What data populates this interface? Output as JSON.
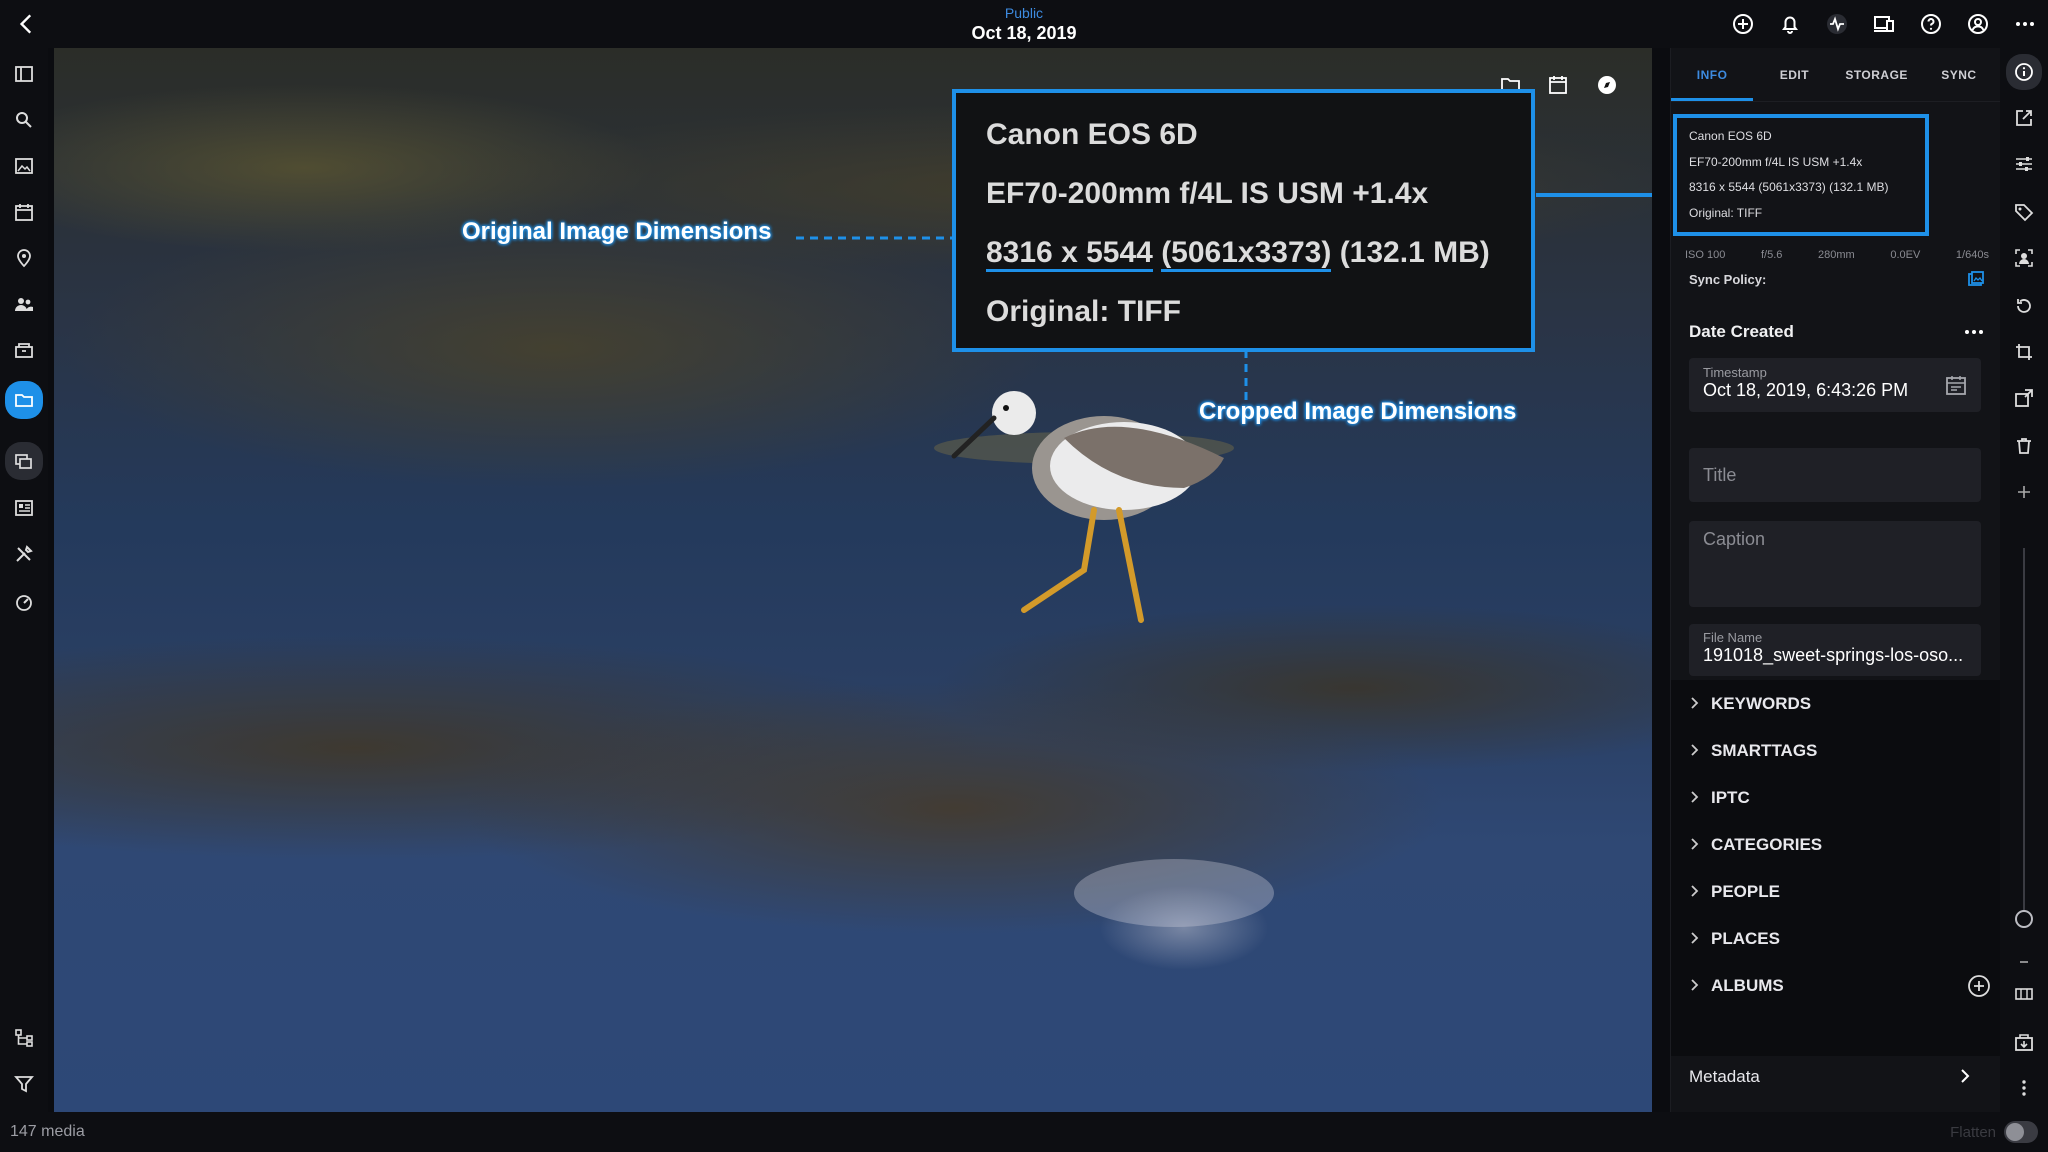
{
  "header": {
    "visibility": "Public",
    "date": "Oct 18, 2019",
    "icons": [
      "add-circle-icon",
      "bell-icon",
      "activity-icon",
      "devices-icon",
      "help-icon",
      "account-icon",
      "more-icon"
    ]
  },
  "left_rail": {
    "icons": [
      "sidebar-toggle-icon",
      "search-icon",
      "photos-icon",
      "calendar-icon",
      "map-pin-icon",
      "people-icon",
      "archive-icon",
      "folder-icon",
      "stack-icon",
      "catalog-icon",
      "tools-icon",
      "speed-icon",
      "hierarchy-icon",
      "filter-icon"
    ],
    "active": "folder-icon"
  },
  "viewer": {
    "toolbar_icons": [
      "folder-cloud-icon",
      "calendar-sync-icon",
      "compass-icon"
    ],
    "zoom_callout": {
      "camera": "Canon EOS 6D",
      "lens": "EF70-200mm f/4L IS USM +1.4x",
      "original_dims": "8316 x 5544",
      "cropped_dims": "(5061x3373)",
      "size": "(132.1 MB)",
      "original": "Original: TIFF"
    },
    "annotations": {
      "original_label": "Original Image Dimensions",
      "cropped_label": "Cropped Image Dimensions"
    }
  },
  "panel": {
    "tabs": [
      {
        "label": "INFO",
        "active": true
      },
      {
        "label": "EDIT",
        "active": false
      },
      {
        "label": "STORAGE",
        "active": false
      },
      {
        "label": "SYNC",
        "active": false
      }
    ],
    "exif_lines": [
      "Canon EOS 6D",
      "EF70-200mm f/4L IS USM +1.4x",
      "8316 x 5544 (5061x3373) (132.1 MB)",
      "Original: TIFF"
    ],
    "exif_strip": [
      "ISO 100",
      "f/5.6",
      "280mm",
      "0.0EV",
      "1/640s"
    ],
    "sync_policy_label": "Sync Policy:",
    "date_created": "Date Created",
    "timestamp_label": "Timestamp",
    "timestamp_value": "Oct 18, 2019, 6:43:26 PM",
    "title_placeholder": "Title",
    "caption_placeholder": "Caption",
    "file_name_label": "File Name",
    "file_name_value": "191018_sweet-springs-los-oso...",
    "sections": [
      "KEYWORDS",
      "SMARTTAGS",
      "IPTC",
      "CATEGORIES",
      "PEOPLE",
      "PLACES",
      "ALBUMS"
    ],
    "metadata_label": "Metadata"
  },
  "right_rail": {
    "icons": [
      "info-icon",
      "open-external-icon",
      "adjust-icon",
      "tag-icon",
      "face-icon",
      "rotate-icon",
      "crop-rotate-icon",
      "export-icon",
      "trash-icon",
      "zoom-in-icon",
      "zoom-out-icon",
      "compare-icon",
      "archive-box-icon",
      "more-vertical-icon"
    ]
  },
  "footer": {
    "media_count": "147 media",
    "flatten_label": "Flatten"
  },
  "colors": {
    "accent": "#1e90e8",
    "public_text": "#3d8be0",
    "background": "#0d0e12"
  }
}
